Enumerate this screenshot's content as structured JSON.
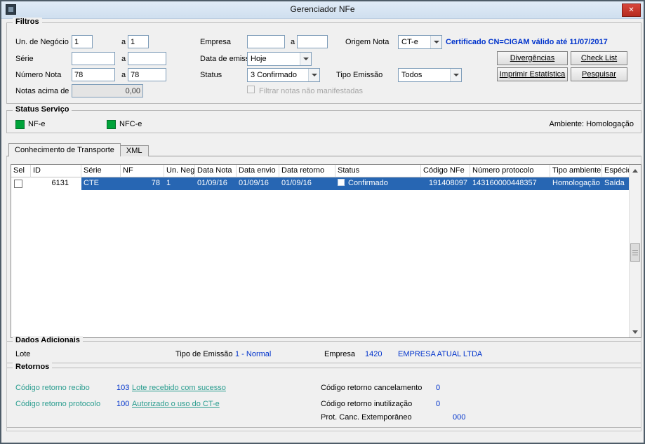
{
  "window": {
    "title": "Gerenciador NFe",
    "close_glyph": "✕"
  },
  "colors": {
    "accent_blue": "#0033cc",
    "link_teal": "#2a9d8f",
    "status_green": "#00a33a",
    "selected_row_blue": "#2766b3",
    "close_red": "#c0392b"
  },
  "filters": {
    "title": "Filtros",
    "range_separator": "a",
    "un_negocio": {
      "label": "Un. de Negócio",
      "from": "1",
      "to": "1"
    },
    "serie": {
      "label": "Série",
      "from": "",
      "to": ""
    },
    "numero_nota": {
      "label": "Número Nota",
      "from": "78",
      "to": "78"
    },
    "notas_acima": {
      "label": "Notas acima de",
      "value": "0,00"
    },
    "empresa": {
      "label": "Empresa",
      "from": "",
      "to": ""
    },
    "data_emissao": {
      "label": "Data de emissão",
      "value": "Hoje"
    },
    "status": {
      "label": "Status",
      "value": "3 Confirmado"
    },
    "origem_nota": {
      "label": "Origem Nota",
      "value": "CT-e"
    },
    "tipo_emissao": {
      "label": "Tipo Emissão",
      "value": "Todos"
    },
    "certificado": "Certificado CN=CIGAM válido até 11/07/2017",
    "filtrar_nao_manifestadas": "Filtrar notas não manifestadas",
    "buttons": {
      "divergencias": "Divergências",
      "check_list": "Check List",
      "imprimir_estatistica": "Imprimir Estatística",
      "pesquisar": "Pesquisar"
    }
  },
  "status_servico": {
    "title": "Status Serviço",
    "nfe_label": "NF-e",
    "nfce_label": "NFC-e",
    "ambiente": "Ambiente: Homologação"
  },
  "tabs": [
    {
      "label": "Conhecimento de Transporte",
      "active": true
    },
    {
      "label": "XML",
      "active": false
    }
  ],
  "table": {
    "headers": [
      "Sel",
      "ID",
      "Série",
      "NF",
      "Un. Neg.",
      "Data Nota",
      "Data envio",
      "Data retorno",
      "Status",
      "Código NFe",
      "Número protocolo",
      "Tipo ambiente",
      "Espécie"
    ],
    "rows": [
      {
        "sel_checked": false,
        "id": "6131",
        "serie": "CTE",
        "nf": "78",
        "un_neg": "1",
        "data_nota": "01/09/16",
        "data_envio": "01/09/16",
        "data_retorno": "01/09/16",
        "status_checked": false,
        "status": "Confirmado",
        "codigo_nfe": "191408097",
        "numero_protocolo": "143160000448357",
        "tipo_ambiente": "Homologação",
        "especie": "Saída"
      }
    ]
  },
  "dados_adicionais": {
    "title": "Dados Adicionais",
    "lote_label": "Lote",
    "lote_value": "",
    "tipo_emissao_label": "Tipo de Emissão",
    "tipo_emissao_value": "1 - Normal",
    "empresa_label": "Empresa",
    "empresa_codigo": "1420",
    "empresa_nome": "EMPRESA ATUAL LTDA"
  },
  "retornos": {
    "title": "Retornos",
    "recibo_label": "Código retorno recibo",
    "recibo_codigo": "103",
    "recibo_msg": "Lote recebido com sucesso",
    "protocolo_label": "Código retorno protocolo",
    "protocolo_codigo": "100",
    "protocolo_msg": "Autorizado o uso do CT-e",
    "cancelamento_label": "Código retorno cancelamento",
    "cancelamento_codigo": "0",
    "inutilizacao_label": "Código retorno inutilização",
    "inutilizacao_codigo": "0",
    "prot_canc_label": "Prot. Canc. Extemporâneo",
    "prot_canc_codigo": "000"
  }
}
